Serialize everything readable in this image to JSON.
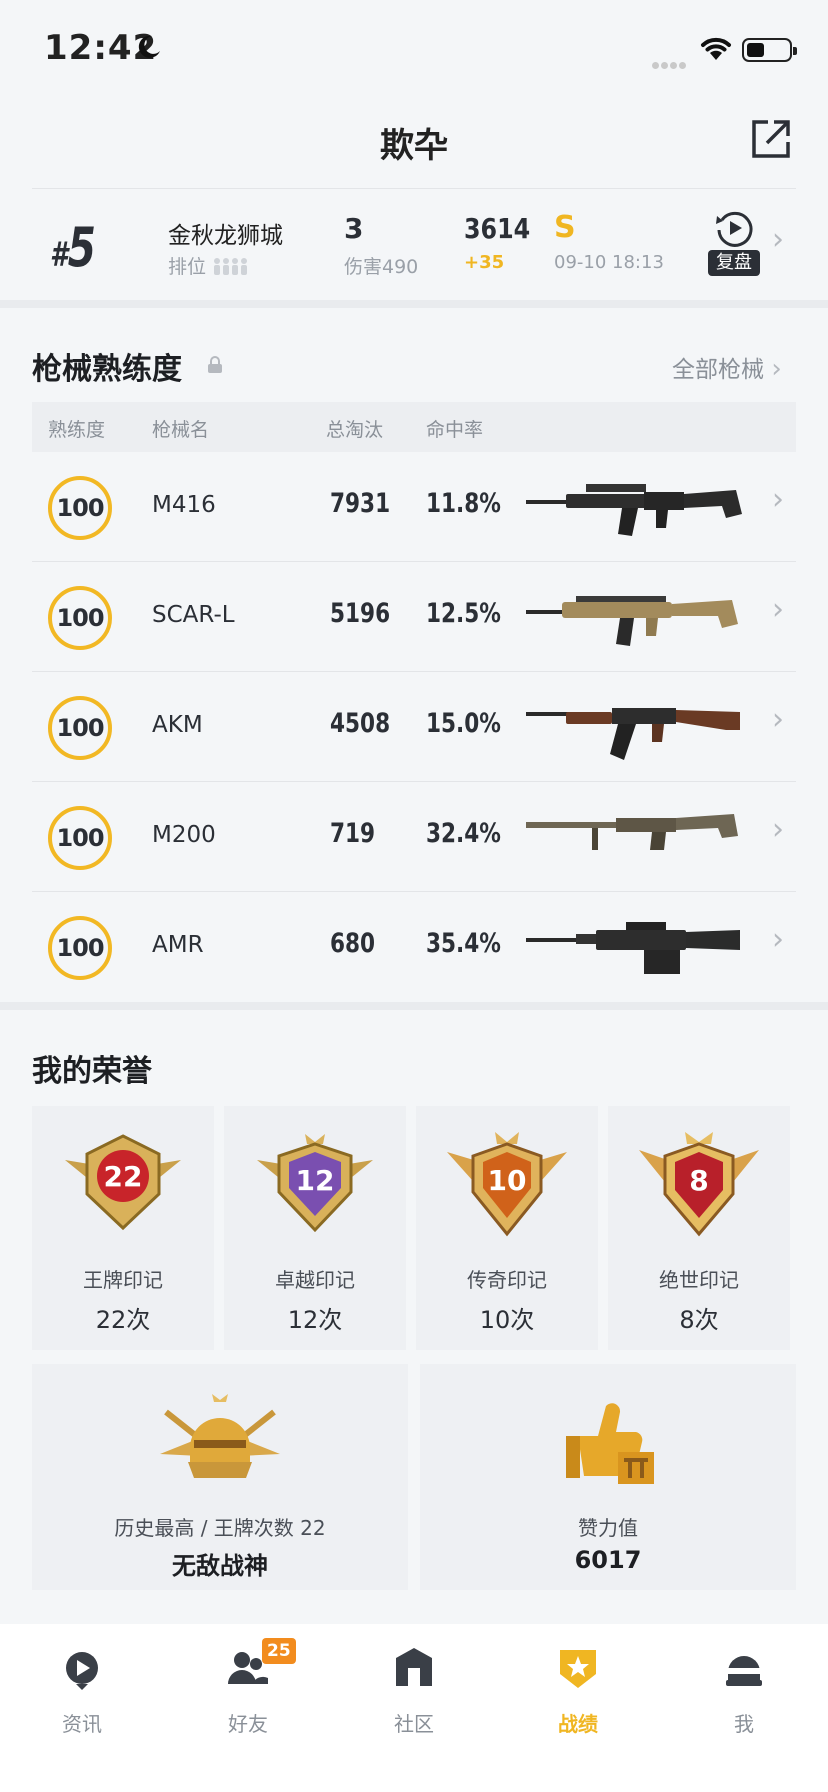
{
  "status_bar": {
    "time": "12:42",
    "icons": [
      "moon-icon",
      "signal-icon",
      "wifi-icon",
      "battery-icon"
    ]
  },
  "header": {
    "title": "欺卆",
    "share_icon": "external-link-icon"
  },
  "latest_match": {
    "rank_hash": "#",
    "rank": "5",
    "map": "金秋龙狮城",
    "rank_label": "排位",
    "kills": "3",
    "damage": "伤害490",
    "score": "3614",
    "score_delta": "+35",
    "grade": "S",
    "time": "09-10 18:13",
    "replay_label": "复盘"
  },
  "weapons": {
    "title": "枪械熟练度",
    "all_link": "全部枪械",
    "columns": [
      "熟练度",
      "枪械名",
      "总淘汰",
      "命中率"
    ],
    "rows": [
      {
        "proficiency": "100",
        "name": "M416",
        "kills": "7931",
        "hit_rate": "11.8%"
      },
      {
        "proficiency": "100",
        "name": "SCAR-L",
        "kills": "5196",
        "hit_rate": "12.5%"
      },
      {
        "proficiency": "100",
        "name": "AKM",
        "kills": "4508",
        "hit_rate": "15.0%"
      },
      {
        "proficiency": "100",
        "name": "M200",
        "kills": "719",
        "hit_rate": "32.4%"
      },
      {
        "proficiency": "100",
        "name": "AMR",
        "kills": "680",
        "hit_rate": "35.4%"
      }
    ]
  },
  "honors": {
    "title": "我的荣誉",
    "badges": [
      {
        "number": "22",
        "name": "王牌印记",
        "count": "22次",
        "color": "#c8242a"
      },
      {
        "number": "12",
        "name": "卓越印记",
        "count": "12次",
        "color": "#7a4fb0"
      },
      {
        "number": "10",
        "name": "传奇印记",
        "count": "10次",
        "color": "#d0621a"
      },
      {
        "number": "8",
        "name": "绝世印记",
        "count": "8次",
        "color": "#b8202a"
      }
    ],
    "highest": {
      "label": "历史最高 / 王牌次数 22",
      "value": "无敌战神"
    },
    "likes": {
      "label": "赞力值",
      "value": "6017"
    }
  },
  "tabs": [
    {
      "label": "资讯",
      "icon": "news-icon"
    },
    {
      "label": "好友",
      "icon": "friends-icon",
      "badge": "25"
    },
    {
      "label": "社区",
      "icon": "community-icon"
    },
    {
      "label": "战绩",
      "icon": "record-icon",
      "active": true
    },
    {
      "label": "我",
      "icon": "profile-icon"
    }
  ],
  "colors": {
    "accent": "#f0b622",
    "text": "#2b2f36",
    "muted": "#8a9098"
  }
}
